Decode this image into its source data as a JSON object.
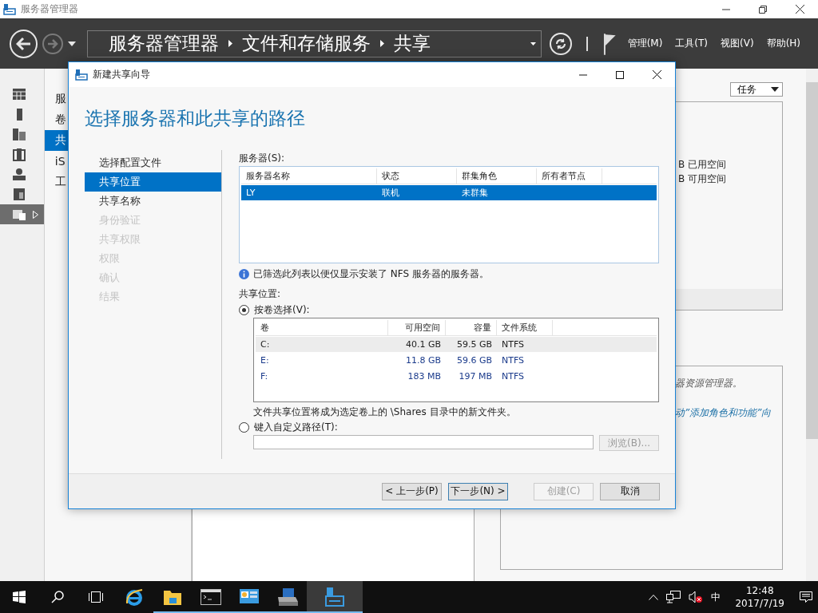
{
  "app": {
    "title": "服务器管理器"
  },
  "nav": {
    "breadcrumb": [
      "服务器管理器",
      "文件和存储服务",
      "共享"
    ],
    "menus": [
      "管理(M)",
      "工具(T)",
      "视图(V)",
      "帮助(H)"
    ]
  },
  "sidebar": {
    "items": [
      {
        "kind": "dashboard",
        "selected": false
      },
      {
        "kind": "local",
        "selected": false
      },
      {
        "kind": "all",
        "selected": false
      },
      {
        "kind": "files",
        "selected": false
      },
      {
        "kind": "iis",
        "selected": false
      },
      {
        "kind": "roles",
        "selected": false
      },
      {
        "kind": "storage",
        "selected": true
      }
    ]
  },
  "nav_panel": {
    "items": [
      {
        "label": "服",
        "selected": false
      },
      {
        "label": "卷",
        "selected": false
      },
      {
        "label": "共",
        "selected": true
      },
      {
        "label": "iS",
        "selected": false
      },
      {
        "label": "工",
        "selected": false
      }
    ]
  },
  "tasks_button": "任务",
  "volume_panel": {
    "lines": [
      "B 已用空间",
      "B 可用空间"
    ]
  },
  "info_panel": {
    "lines": [
      {
        "text": "器资源管理器。",
        "kind": "plain"
      },
      {
        "text": "动”添加角色和功能”向",
        "kind": "link"
      }
    ]
  },
  "dialog": {
    "title": "新建共享向导",
    "heading": "选择服务器和此共享的路径",
    "steps": [
      {
        "label": "选择配置文件",
        "selected": false,
        "disabled": false
      },
      {
        "label": "共享位置",
        "selected": true,
        "disabled": false
      },
      {
        "label": "共享名称",
        "selected": false,
        "disabled": false
      },
      {
        "label": "身份验证",
        "selected": false,
        "disabled": true
      },
      {
        "label": "共享权限",
        "selected": false,
        "disabled": true
      },
      {
        "label": "权限",
        "selected": false,
        "disabled": true
      },
      {
        "label": "确认",
        "selected": false,
        "disabled": true
      },
      {
        "label": "结果",
        "selected": false,
        "disabled": true
      }
    ],
    "servers": {
      "label": "服务器(S):",
      "columns": [
        "服务器名称",
        "状态",
        "群集角色",
        "所有者节点"
      ],
      "rows": [
        {
          "cells": [
            "LY",
            "联机",
            "未群集",
            ""
          ],
          "selected": true
        }
      ]
    },
    "note": "已筛选此列表以便仅显示安装了 NFS 服务器的服务器。",
    "location_label": "共享位置:",
    "options": [
      {
        "label": "按卷选择(V):",
        "selected": true
      },
      {
        "label": "键入自定义路径(T):",
        "selected": false
      }
    ],
    "volumes": {
      "columns": [
        "卷",
        "可用空间",
        "容量",
        "文件系统"
      ],
      "rows": [
        {
          "cells": [
            "C:",
            "40.1 GB",
            "59.5 GB",
            "NTFS"
          ],
          "selected": true
        },
        {
          "cells": [
            "E:",
            "11.8 GB",
            "59.6 GB",
            "NTFS"
          ],
          "selected": false
        },
        {
          "cells": [
            "F:",
            "183 MB",
            "197 MB",
            "NTFS"
          ],
          "selected": false
        }
      ]
    },
    "volume_note": "文件共享位置将成为选定卷上的 \\Shares 目录中的新文件夹。",
    "browse": {
      "label": "浏览(B)...",
      "disabled": true
    },
    "buttons": [
      {
        "label": "< 上一步(P)",
        "disabled": false,
        "default": false
      },
      {
        "label": "下一步(N) >",
        "disabled": false,
        "default": true
      },
      {
        "label": "创建(C)",
        "disabled": true,
        "default": false
      },
      {
        "label": "取消",
        "disabled": false,
        "default": false
      }
    ]
  },
  "taskbar": {
    "apps": [
      {
        "kind": "ie",
        "running": false,
        "selected": false
      },
      {
        "kind": "folder",
        "running": true,
        "selected": false
      },
      {
        "kind": "cmd",
        "running": true,
        "selected": false
      },
      {
        "kind": "panel",
        "running": true,
        "selected": false
      },
      {
        "kind": "printer",
        "running": true,
        "selected": false
      },
      {
        "kind": "server",
        "running": true,
        "selected": true
      }
    ],
    "ime": "中",
    "time": "12:48",
    "date": "2017/7/19"
  }
}
